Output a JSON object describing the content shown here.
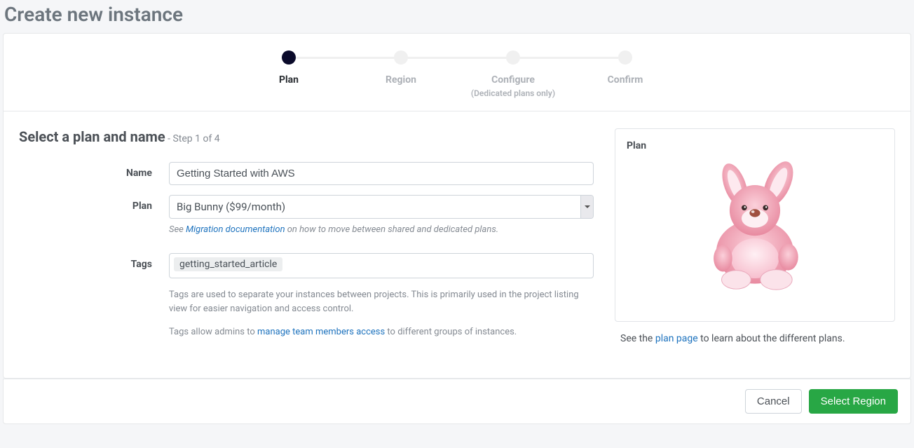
{
  "page_title": "Create new instance",
  "stepper": {
    "items": [
      {
        "label": "Plan",
        "sub": "",
        "active": true
      },
      {
        "label": "Region",
        "sub": "",
        "active": false
      },
      {
        "label": "Configure",
        "sub": "(Dedicated plans only)",
        "active": false
      },
      {
        "label": "Confirm",
        "sub": "",
        "active": false
      }
    ]
  },
  "section": {
    "heading": "Select a plan and name",
    "step_text": "- Step 1 of 4"
  },
  "form": {
    "name": {
      "label": "Name",
      "value": "Getting Started with AWS"
    },
    "plan": {
      "label": "Plan",
      "selected": "Big Bunny ($99/month)",
      "hint_prefix": "See ",
      "hint_link": "Migration documentation",
      "hint_suffix": " on how to move between shared and dedicated plans."
    },
    "tags": {
      "label": "Tags",
      "chips": [
        "getting_started_article"
      ],
      "hint1": "Tags are used to separate your instances between projects. This is primarily used in the project listing view for easier navigation and access control.",
      "hint2_prefix": "Tags allow admins to ",
      "hint2_link": "manage team members access",
      "hint2_suffix": " to different groups of instances."
    }
  },
  "plan_panel": {
    "title": "Plan",
    "hint_prefix": "See the ",
    "hint_link": "plan page",
    "hint_suffix": " to learn about the different plans."
  },
  "footer": {
    "cancel": "Cancel",
    "next": "Select Region"
  },
  "colors": {
    "accent_green": "#28a745",
    "link_blue": "#1e73be",
    "bunny_pink": "#f2a7b8",
    "bunny_pink_dark": "#d87a90"
  }
}
